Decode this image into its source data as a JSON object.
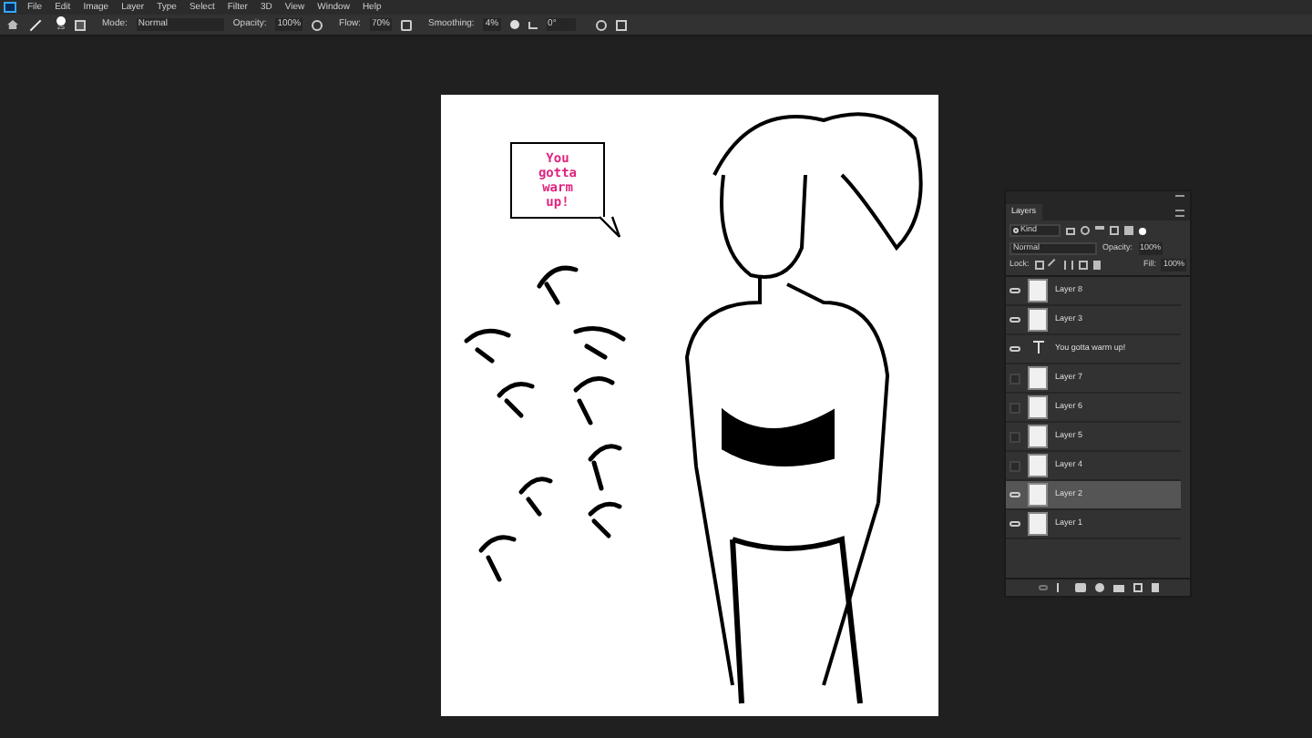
{
  "menu": [
    "File",
    "Edit",
    "Image",
    "Layer",
    "Type",
    "Select",
    "Filter",
    "3D",
    "View",
    "Window",
    "Help"
  ],
  "options": {
    "brush_size": "25",
    "mode_label": "Mode:",
    "mode": "Normal",
    "opacity_label": "Opacity:",
    "opacity": "100%",
    "flow_label": "Flow:",
    "flow": "70%",
    "smoothing_label": "Smoothing:",
    "smoothing": "4%",
    "angle": "0°"
  },
  "canvas": {
    "speech_bubble": "You gotta warm up!"
  },
  "layers_panel": {
    "title": "Layers",
    "filter": "Kind",
    "blend_mode": "Normal",
    "opacity_label": "Opacity:",
    "opacity": "100%",
    "lock_label": "Lock:",
    "fill_label": "Fill:",
    "fill": "100%",
    "layers": [
      {
        "name": "Layer 8",
        "kind": "pixel",
        "visible": true,
        "selected": false
      },
      {
        "name": "Layer 3",
        "kind": "pixel",
        "visible": true,
        "selected": false
      },
      {
        "name": "You gotta warm up!",
        "kind": "text",
        "visible": true,
        "selected": false
      },
      {
        "name": "Layer 7",
        "kind": "pixel",
        "visible": false,
        "selected": false
      },
      {
        "name": "Layer 6",
        "kind": "pixel",
        "visible": false,
        "selected": false
      },
      {
        "name": "Layer 5",
        "kind": "pixel",
        "visible": false,
        "selected": false
      },
      {
        "name": "Layer 4",
        "kind": "pixel",
        "visible": false,
        "selected": false
      },
      {
        "name": "Layer 2",
        "kind": "pixel",
        "visible": true,
        "selected": true
      },
      {
        "name": "Layer 1",
        "kind": "pixel",
        "visible": true,
        "selected": false
      }
    ]
  }
}
